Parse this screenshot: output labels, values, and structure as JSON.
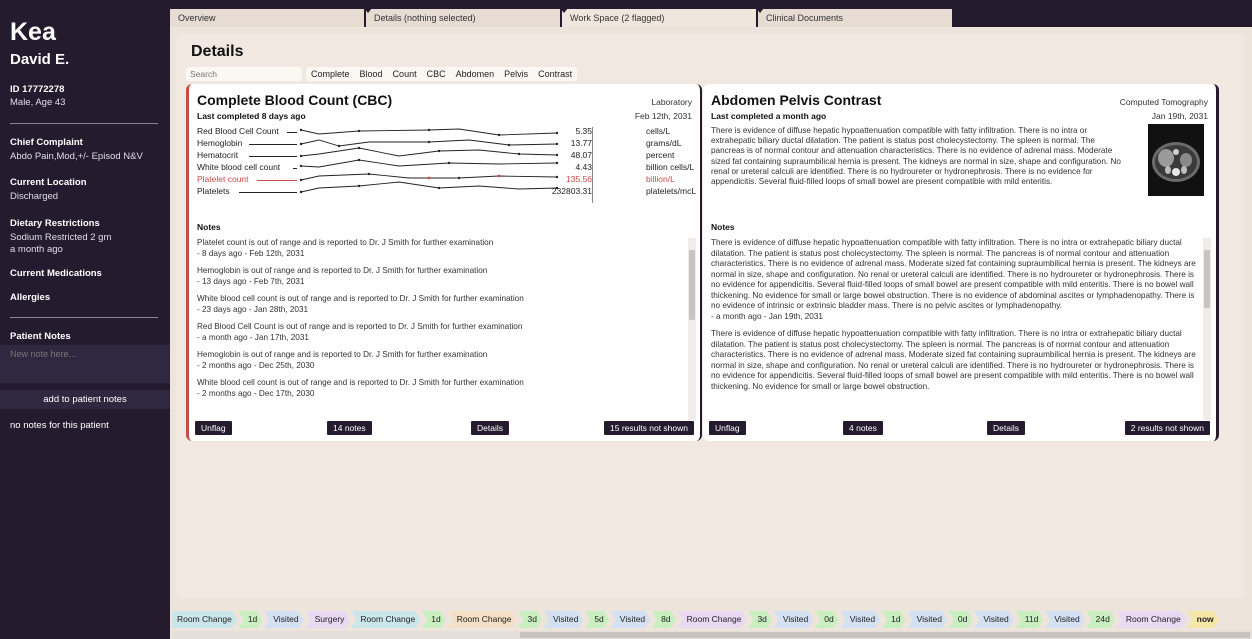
{
  "sidebar": {
    "app_name": "Kea",
    "patient_name": "David E.",
    "patient_id": "ID 17772278",
    "demographics": "Male, Age 43",
    "chief_complaint_label": "Chief Complaint",
    "chief_complaint": "Abdo Pain,Mod,+/- Episod N&V",
    "location_label": "Current Location",
    "location": "Discharged",
    "diet_label": "Dietary Restrictions",
    "diet_line1": "Sodium Restricted 2 gm",
    "diet_line2": "a month ago",
    "medications_label": "Current Medications",
    "allergies_label": "Allergies",
    "patient_notes_label": "Patient Notes",
    "new_note_placeholder": "New note here...",
    "add_note_label": "add to patient notes",
    "no_notes": "no notes for this patient"
  },
  "tabs": [
    {
      "label": "Overview"
    },
    {
      "label": "Details (nothing selected)"
    },
    {
      "label": "Work Space (2 flagged)"
    },
    {
      "label": "Clinical Documents"
    }
  ],
  "details": {
    "title": "Details",
    "search_placeholder": "Search",
    "filters": [
      "Complete",
      "Blood",
      "Count",
      "CBC",
      "Abdomen",
      "Pelvis",
      "Contrast"
    ]
  },
  "cbc": {
    "title": "Complete Blood Count (CBC)",
    "subtitle": "Last completed 8 days ago",
    "type": "Laboratory",
    "date": "Feb 12th, 2031",
    "labs": [
      {
        "name": "Red Blood Cell Count",
        "value": "5.35",
        "unit": "cells/L",
        "flagged": false
      },
      {
        "name": "Hemoglobin",
        "value": "13.77",
        "unit": "grams/dL",
        "flagged": false
      },
      {
        "name": "Hematocrit",
        "value": "48.07",
        "unit": "percent",
        "flagged": false
      },
      {
        "name": "White blood cell count",
        "value": "4.43",
        "unit": "billion cells/L",
        "flagged": false
      },
      {
        "name": "Platelet count",
        "value": "135.56",
        "unit": "billion/L",
        "flagged": true
      },
      {
        "name": "Platelets",
        "value": "232803.31",
        "unit": "platelets/mcL",
        "flagged": false
      }
    ],
    "notes_label": "Notes",
    "notes": [
      {
        "text": "Platelet count is out of range and is reported to Dr. J Smith for further examination",
        "meta": "- 8 days ago - Feb 12th, 2031"
      },
      {
        "text": "Hemoglobin is out of range and is reported to Dr. J Smith for further examination",
        "meta": "- 13 days ago - Feb 7th, 2031"
      },
      {
        "text": "White blood cell count is out of range and is reported to Dr. J Smith for further examination",
        "meta": "- 23 days ago - Jan 28th, 2031"
      },
      {
        "text": "Red Blood Cell Count is out of range and is reported to Dr. J Smith for further examination",
        "meta": "- a month ago - Jan 17th, 2031"
      },
      {
        "text": "Hemoglobin is out of range and is reported to Dr. J Smith for further examination",
        "meta": "- 2 months ago - Dec 25th, 2030"
      },
      {
        "text": "White blood cell count is out of range and is reported to Dr. J Smith for further examination",
        "meta": "- 2 months ago - Dec 17th, 2030"
      }
    ],
    "footer": {
      "unflag": "Unflag",
      "notes": "14 notes",
      "details": "Details",
      "hidden": "15 results not shown"
    }
  },
  "apc": {
    "title": "Abdomen Pelvis Contrast",
    "subtitle": "Last completed a month ago",
    "type": "Computed Tomography",
    "date": "Jan 19th, 2031",
    "summary": "There is evidence of diffuse hepatic hypoattenuation compatible with fatty infiltration. There is no intra or extrahepatic biliary ductal dilatation. The patient is status post cholecystectomy. The spleen is normal. The pancreas is of normal contour and attenuation characteristics. There is no evidence of adrenal mass. Moderate sized fat containing supraumbilical hernia is present. The kidneys are normal in size, shape and configuration. No renal or ureteral calculi are identified. There is no hydroureter or hydronephrosis. There is no evidence for appendicitis. Several fluid-filled loops of small bowel are present compatible with mild enteritis.",
    "notes_label": "Notes",
    "notes": [
      {
        "text": "There is evidence of diffuse hepatic hypoattenuation compatible with fatty infiltration. There is no intra or extrahepatic biliary ductal dilatation. The patient is status post cholecystectomy. The spleen is normal. The pancreas is of normal contour and attenuation characteristics. There is no evidence of adrenal mass. Moderate sized fat containing supraumbilical hernia is present. The kidneys are normal in size, shape and configuration. No renal or ureteral calculi are identified. There is no hydroureter or hydronephrosis. There is no evidence for appendicitis. Several fluid-filled loops of small bowel are present compatible with mild enteritis. There is no bowel wall thickening. No evidence for small or large bowel obstruction. There is no evidence of abdominal ascites or lymphadenopathy. There is no evidence of intrinsic or extrinsic bladder mass. There is no pelvic ascites or lymphadenopathy.",
        "meta": "- a month ago - Jan 19th, 2031"
      },
      {
        "text": "There is evidence of diffuse hepatic hypoattenuation compatible with fatty infiltration. There is no intra or extrahepatic biliary ductal dilatation. The patient is status post cholecystectomy. The spleen is normal. The pancreas is of normal contour and attenuation characteristics. There is no evidence of adrenal mass. Moderate sized fat containing supraumbilical hernia is present. The kidneys are normal in size, shape and configuration. No renal or ureteral calculi are identified. There is no hydroureter or hydronephrosis. There is no evidence for appendicitis. Several fluid-filled loops of small bowel are present compatible with mild enteritis. There is no bowel wall thickening. No evidence for small or large bowel obstruction.",
        "meta": ""
      }
    ],
    "footer": {
      "unflag": "Unflag",
      "notes": "4 notes",
      "details": "Details",
      "hidden": "2 results not shown"
    }
  },
  "timeline": [
    {
      "label": "Room Change",
      "kind": "room"
    },
    {
      "label": "1d",
      "kind": "gap"
    },
    {
      "label": "Visited",
      "kind": "vis"
    },
    {
      "label": "Surgery",
      "kind": "surg"
    },
    {
      "label": "Room Change",
      "kind": "room"
    },
    {
      "label": "1d",
      "kind": "gap"
    },
    {
      "label": "Room Change",
      "kind": "rc2"
    },
    {
      "label": "3d",
      "kind": "gap"
    },
    {
      "label": "Visited",
      "kind": "vis"
    },
    {
      "label": "5d",
      "kind": "gap"
    },
    {
      "label": "Visited",
      "kind": "vis"
    },
    {
      "label": "8d",
      "kind": "gap"
    },
    {
      "label": "Room Change",
      "kind": "surg"
    },
    {
      "label": "3d",
      "kind": "gap"
    },
    {
      "label": "Visited",
      "kind": "vis"
    },
    {
      "label": "0d",
      "kind": "gap"
    },
    {
      "label": "Visited",
      "kind": "vis"
    },
    {
      "label": "1d",
      "kind": "gap"
    },
    {
      "label": "Visited",
      "kind": "vis"
    },
    {
      "label": "0d",
      "kind": "gap"
    },
    {
      "label": "Visited",
      "kind": "vis"
    },
    {
      "label": "11d",
      "kind": "gap"
    },
    {
      "label": "Visited",
      "kind": "vis"
    },
    {
      "label": "24d",
      "kind": "gap"
    },
    {
      "label": "Room Change",
      "kind": "surg"
    },
    {
      "label": "now",
      "kind": "now"
    }
  ],
  "colors": {
    "sidebar_bg": "#241b2f",
    "flag_red": "#c94b48",
    "panel_bg": "#f1e9e1"
  }
}
